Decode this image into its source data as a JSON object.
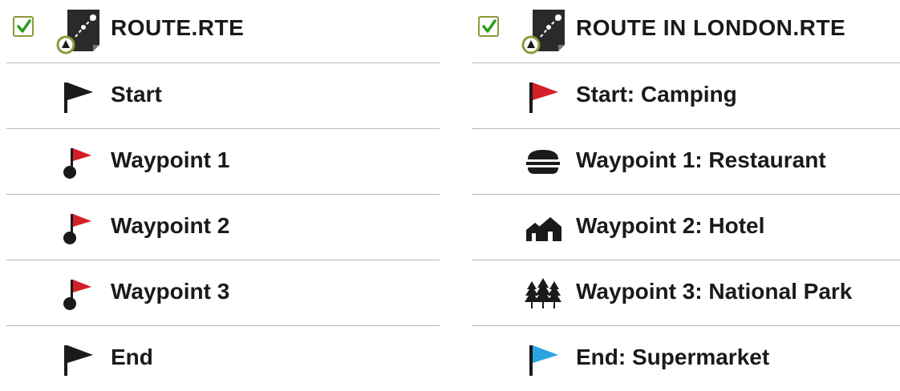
{
  "left": {
    "title": "ROUTE.RTE",
    "checked": true,
    "items": [
      {
        "label": "Start",
        "icon": "black-flag-icon"
      },
      {
        "label": "Waypoint 1",
        "icon": "waypoint-flag-icon"
      },
      {
        "label": "Waypoint 2",
        "icon": "waypoint-flag-icon"
      },
      {
        "label": "Waypoint 3",
        "icon": "waypoint-flag-icon"
      },
      {
        "label": "End",
        "icon": "black-flag-icon"
      }
    ]
  },
  "right": {
    "title": "ROUTE IN LONDON.RTE",
    "checked": true,
    "items": [
      {
        "label": "Start: Camping",
        "icon": "red-flag-icon"
      },
      {
        "label": "Waypoint 1: Restaurant",
        "icon": "restaurant-icon"
      },
      {
        "label": "Waypoint 2: Hotel",
        "icon": "hotel-icon"
      },
      {
        "label": "Waypoint 3: National Park",
        "icon": "national-park-icon"
      },
      {
        "label": "End: Supermarket",
        "icon": "blue-flag-icon"
      }
    ]
  },
  "colors": {
    "check_border": "#8d9a3b",
    "check_mark": "#2f9e1e",
    "flag_red": "#d41f26",
    "flag_blue": "#2aa3e0",
    "flag_black": "#1a1a1a",
    "separator": "#b8b8b8"
  }
}
